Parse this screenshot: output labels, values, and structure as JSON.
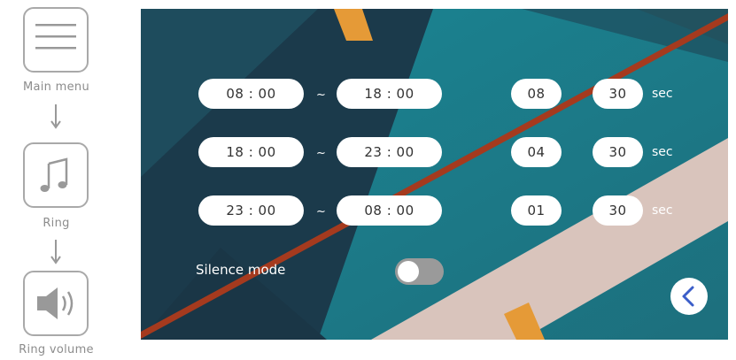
{
  "nav": {
    "main_menu_label": "Main menu",
    "ring_label": "Ring",
    "ring_volume_label": "Ring volume",
    "icons": [
      "hamburger-menu-icon",
      "music-note-icon",
      "speaker-volume-icon",
      "arrow-down-icon"
    ]
  },
  "schedule": [
    {
      "start": "08 : 00",
      "separator": "~",
      "end": "18 : 00",
      "volume": "08",
      "duration": "30",
      "unit": "sec"
    },
    {
      "start": "18 : 00",
      "separator": "~",
      "end": "23 : 00",
      "volume": "04",
      "duration": "30",
      "unit": "sec"
    },
    {
      "start": "23 : 00",
      "separator": "~",
      "end": "08 : 00",
      "volume": "01",
      "duration": "30",
      "unit": "sec"
    }
  ],
  "silence_mode": {
    "label": "Silence mode",
    "enabled": false
  },
  "colors": {
    "bg_dark": "#1b3a4b",
    "bg_teal": "#1e7f8e",
    "stripe_red": "#a53a1e",
    "band_beige": "#d9c4bc",
    "accent_orange": "#e59a37",
    "toggle_off": "#9a9a9a",
    "back_arrow": "#3b5ec9"
  }
}
